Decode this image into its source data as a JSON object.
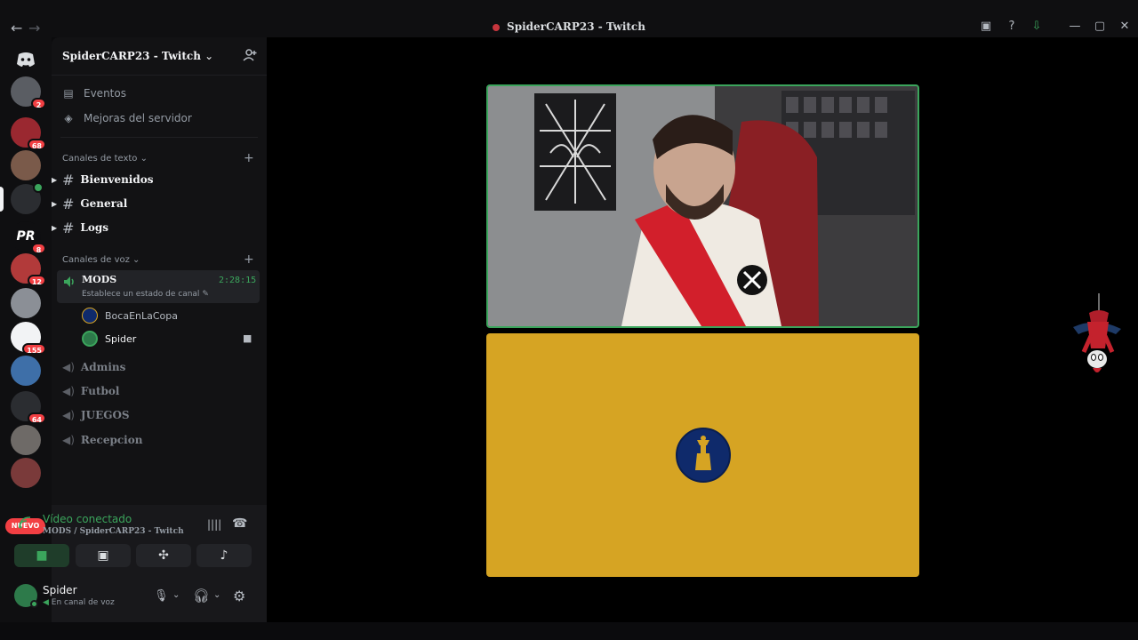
{
  "window": {
    "title": "SpiderCARP23 - Twitch",
    "nav_back": "←",
    "nav_forward": "→"
  },
  "guilds": {
    "badges": [
      "2",
      "68",
      "8",
      "12",
      "155",
      "64"
    ],
    "new_label": "NUEVO"
  },
  "server": {
    "name": "SpiderCARP23 - Twitch",
    "menu": [
      "Eventos",
      "Mejoras del servidor"
    ],
    "text_category": "Canales de texto",
    "text_channels": [
      "Bienvenidos",
      "General",
      "Logs"
    ],
    "voice_category": "Canales de voz",
    "active_voice": {
      "name": "MODS",
      "status": "Establece un estado de canal",
      "timer": "2:28:15"
    },
    "members": [
      "BocaEnLaCopa",
      "Spider"
    ],
    "voice_channels": [
      "Admins",
      "Futbol",
      "JUEGOS",
      "Recepcion"
    ]
  },
  "voice_panel": {
    "connected": "Vídeo conectado",
    "path": "MODS / SpiderCARP23 - Twitch"
  },
  "user": {
    "name": "Spider",
    "status": "En canal de voz"
  },
  "colors": {
    "accent_green": "#3ba55c",
    "badge_red": "#f23f43",
    "tile_yellow": "#d6a423"
  }
}
